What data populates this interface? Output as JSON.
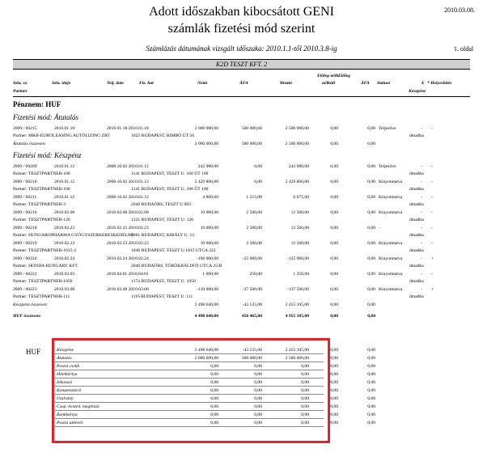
{
  "report": {
    "title_line1": "Adott időszakban kibocsátott GENI",
    "title_line2": "számlák fizetési mód szerint",
    "date": "2010.03.08.",
    "period": "Számlázás dátumának vizsgált időszaka: 2010.1.1-től 2010.3.8-ig",
    "page": "1. oldal",
    "company": "K2D TESZT KFT. 2"
  },
  "headers": {
    "szla_sz": "Szla. sz.",
    "szla_ideje": "Szla. ideje",
    "telj_date": "Telj. date",
    "fiz_hat": "Fiz. hat",
    "netto": "Nettó",
    "afa": "ÁFA",
    "brutto": "Bruttó",
    "eloleg_nelkul": "Előleg nélk.",
    "eloleg_nelkuli": "nélküli",
    "eloleg2": "Előleg",
    "afa2": "ÁFA",
    "statusz": "Státusz",
    "e": "E",
    "helyesbites": "* Helyesbítés",
    "keszpenz": "Készpénz",
    "partner": "Partner"
  },
  "currency_label": "Pénznem: HUF",
  "sections": [
    {
      "title": "Fizetési mód: Átutalás",
      "rows": [
        {
          "sz": "2009 / 00215",
          "ideje": "2010.01.18",
          "telj": "2010.01.18 2010.01.18",
          "netto": "2 000 000,00",
          "afa": "500 000,00",
          "brutto": "2 500 000,00",
          "e1": "0,00",
          "e2": "0,00",
          "status": "Teljesítve",
          "m1": "-",
          "m2": "-",
          "partner": "Partner: MKB-EUROLEASING AUTÓLIZING ZRT",
          "addr": "1022 BUDAPEST, BIMBÓ ÚT 56.",
          "pay": "dmadba"
        }
      ],
      "total_label": "Átutalás összesen:",
      "total": {
        "netto": "2 000 000,00",
        "afa": "500 000,00",
        "brutto": "2 500 000,00",
        "e1": "0,00",
        "e2": "0,00"
      }
    },
    {
      "title": "Fizetési mód: Készpénz",
      "rows": [
        {
          "sz": "2009 / 00209",
          "ideje": "2010.01.12",
          "telj": "2008.10.02 2010.01.12",
          "netto": "242 980,00",
          "afa": "0,00",
          "brutto": "242 980,00",
          "e1": "0,00",
          "e2": "0,00",
          "status": "Teljesítve",
          "m1": "-",
          "m2": "-",
          "partner": "Partner: TESZTPARTNER-100",
          "addr": "1141 BUDAPEST, TESZT U. 100 ÜT 100",
          "pay": "dmadba"
        },
        {
          "sz": "2009 / 00210",
          "ideje": "2010.01.12",
          "telj": "2008.10.02 2010.01.12",
          "netto": "2 429 800,00",
          "afa": "0,00",
          "brutto": "2 429 800,00",
          "e1": "0,00",
          "e2": "0,00",
          "status": "Kinyomtatva",
          "m1": "-",
          "m2": "-",
          "partner": "Partner: TESZTPARTNER-100",
          "addr": "1141 BUDAPEST, TESZT U. 100 ÜT 100",
          "pay": "dmadba"
        },
        {
          "sz": "2009 / 00211",
          "ideje": "2010.01.12",
          "telj": "2008.10.02 2010.01.12",
          "netto": "4 860,00",
          "afa": "1 215,00",
          "brutto": "6 075,00",
          "e1": "0,00",
          "e2": "0,00",
          "status": "Kinyomtatva",
          "m1": "-",
          "m2": "-",
          "partner": "Partner: TESZTPARTNER-3",
          "addr": "2040 BUDAÖRS, TESZT U 603",
          "pay": "dmadba"
        },
        {
          "sz": "2009 / 00216",
          "ideje": "2010.02.08",
          "telj": "2010.02.08 2010.02.08",
          "netto": "10 000,00",
          "afa": "2 500,00",
          "brutto": "12 500,00",
          "e1": "0,00",
          "e2": "0,00",
          "status": "Kinyomtatva",
          "m1": "-",
          "m2": "-",
          "partner": "Partner: TESZTPARTNER-126",
          "addr": "1221 BUDAPEST, TESZT U. 126",
          "pay": "dmadba"
        },
        {
          "sz": "2009 / 00218",
          "ideje": "2010.02.23",
          "telj": "2010.02.23 2010.02.23",
          "netto": "10 000,00",
          "afa": "2 500,00",
          "brutto": "12 500,00",
          "e1": "0,00",
          "e2": "0,00",
          "status": "-",
          "m1": "-",
          "m2": "-",
          "partner": "Partner: HUNGAROPHARMA GYÓGYSZERKERESKEDELMI",
          "addr": "1061 BUDAPEST, KIRÁLY U. 12.",
          "pay": "dmadba"
        },
        {
          "sz": "2009 / 00219",
          "ideje": "2010.02.23",
          "telj": "2010.02.23 2010.02.23",
          "netto": "10 000,00",
          "afa": "2 500,00",
          "brutto": "12 500,00",
          "e1": "0,00",
          "e2": "0,00",
          "status": "Kinyomtatva",
          "m1": "-",
          "m2": "-",
          "partner": "Partner: TESZTPARTNER-1015-2",
          "addr": "1046 BUDAPEST, TESZT U 1015 UTCA 222",
          "pay": "dmadba"
        },
        {
          "sz": "2009 / 00220",
          "ideje": "2010.02.24",
          "telj": "2010.02.24 2010.02.24",
          "netto": "-100 000,00",
          "afa": "-25 000,00",
          "brutto": "-125 000,00",
          "e1": "0,00",
          "e2": "0,00",
          "status": "Kinyomtatva",
          "m1": "-",
          "m2": "+",
          "partner": "Partner: HONDA HUNGARY KFT.",
          "addr": "2040 BUDAÖRS, TÖRÖKBÁLINTI UTCA 25/B",
          "pay": "dmadba"
        },
        {
          "sz": "2009 / 00222",
          "ideje": "2010.03.03",
          "telj": "2010.04.01 2010.04.01",
          "netto": "1 000,00",
          "afa": "250,00",
          "brutto": "1 250,00",
          "e1": "0,00",
          "e2": "0,00",
          "status": "Kinyomtatva",
          "m1": "-",
          "m2": "-",
          "partner": "Partner: TESZTPARTNER-1050",
          "addr": "1174 BUDAPEST, TESZT U. 1050",
          "pay": "dmadba"
        },
        {
          "sz": "2009 / 00223",
          "ideje": "2010.03.08",
          "telj": "2010.03.08 2010.03.08",
          "netto": "-110 000,00",
          "afa": "-27 500,00",
          "brutto": "-137 500,00",
          "e1": "0,00",
          "e2": "0,00",
          "status": "Kinyomtatva",
          "m1": "-",
          "m2": "+",
          "partner": "Partner: TESZTPARTNER-111",
          "addr": "1116 BUDAPEST, TESZT U. 111",
          "pay": "dmadba"
        }
      ],
      "total_label": "Készpénz összesen:",
      "total": {
        "netto": "2 498 640,00",
        "afa": "-43 535,00",
        "brutto": "2 455 105,00",
        "e1": "0,00",
        "e2": "0,00"
      }
    }
  ],
  "grand_total": {
    "label": "HUF összesen:",
    "netto": "4 498 640,00",
    "afa": "456 465,00",
    "brutto": "4 955 105,00",
    "e1": "0,00",
    "e2": "0,00"
  },
  "summary": {
    "currency": "HUF",
    "rows": [
      {
        "label": "Készpénz",
        "netto": "2 498 640,00",
        "afa": "-43 535,00",
        "brutto": "2 455 105,00",
        "e1": "0,00",
        "e2": "0,00"
      },
      {
        "label": "Átutalás",
        "netto": "2 000 000,00",
        "afa": "500 000,00",
        "brutto": "2 500 000,00",
        "e1": "0,00",
        "e2": "0,00"
      },
      {
        "label": "Postai csekk",
        "netto": "0,00",
        "afa": "0,00",
        "brutto": "0,00",
        "e1": "0,00",
        "e2": "0,00"
      },
      {
        "label": "Hitelkártya",
        "netto": "0,00",
        "afa": "0,00",
        "brutto": "0,00",
        "e1": "0,00",
        "e2": "0,00"
      },
      {
        "label": "Inkasszó",
        "netto": "0,00",
        "afa": "0,00",
        "brutto": "0,00",
        "e1": "0,00",
        "e2": "0,00"
      },
      {
        "label": "Kompenzáció",
        "netto": "0,00",
        "afa": "0,00",
        "brutto": "0,00",
        "e1": "0,00",
        "e2": "0,00"
      },
      {
        "label": "Utalvány",
        "netto": "0,00",
        "afa": "0,00",
        "brutto": "0,00",
        "e1": "0,00",
        "e2": "0,00"
      },
      {
        "label": "Csop. beszed. megbízás",
        "netto": "0,00",
        "afa": "0,00",
        "brutto": "0,00",
        "e1": "0,00",
        "e2": "0,00"
      },
      {
        "label": "Bankkártya",
        "netto": "0,00",
        "afa": "0,00",
        "brutto": "0,00",
        "e1": "0,00",
        "e2": "0,00"
      },
      {
        "label": "Postai utánvét",
        "netto": "0,00",
        "afa": "0,00",
        "brutto": "0,00",
        "e1": "0,00",
        "e2": "0,00"
      }
    ]
  },
  "highlight_color": "#e0242a"
}
